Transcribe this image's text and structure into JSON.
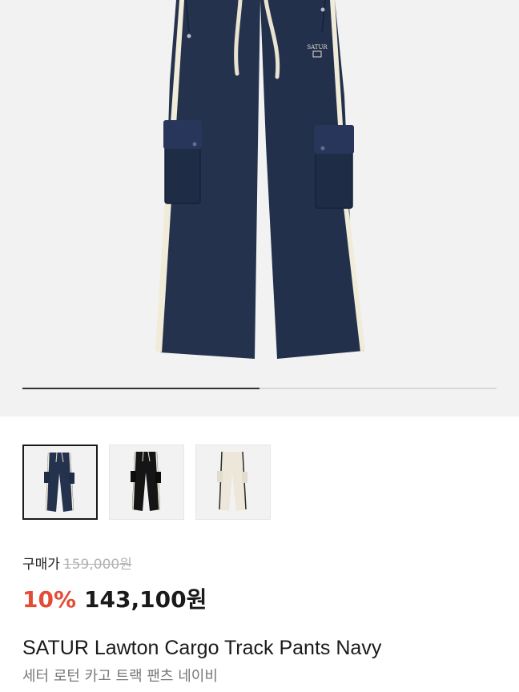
{
  "gallery": {
    "progress_fraction": 0.5,
    "main_image_name": "navy-cargo-track-pants",
    "thumbnails": [
      {
        "color": "navy",
        "selected": true
      },
      {
        "color": "black",
        "selected": false
      },
      {
        "color": "cream",
        "selected": false
      }
    ]
  },
  "price": {
    "buy_label": "구매가",
    "original_price": "159,000원",
    "discount_rate": "10%",
    "sale_price": "143,100원"
  },
  "product": {
    "name_en": "SATUR Lawton Cargo Track Pants Navy",
    "name_ko": "세터 로턴 카고 트랙 팬츠 네이비",
    "logo_text": "SATUR"
  },
  "colors": {
    "discount": "#e34d36",
    "navy": "#24324e",
    "black": "#151515",
    "cream": "#ece7d9",
    "stripe": "#f1ecd9"
  }
}
